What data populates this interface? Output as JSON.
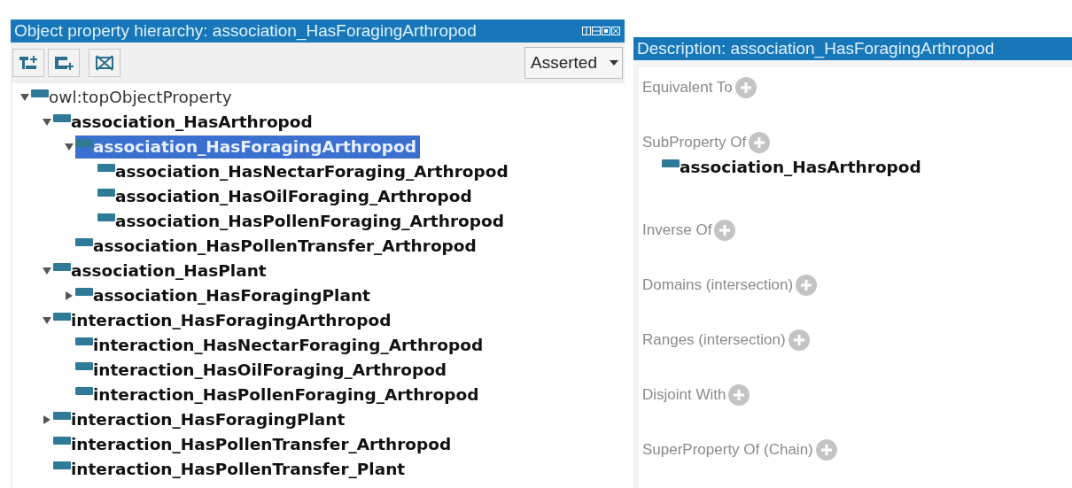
{
  "hierarchy_panel": {
    "title": "Object property hierarchy: association_HasForagingArthropod",
    "view_dropdown": "Asserted",
    "tree": [
      {
        "label": "owl:topObjectProperty",
        "kind": "root",
        "expanded": true,
        "selected": false,
        "children": [
          {
            "label": "association_HasArthropod",
            "kind": "property",
            "expanded": true,
            "selected": false,
            "children": [
              {
                "label": "association_HasForagingArthropod",
                "kind": "property",
                "expanded": true,
                "selected": true,
                "children": [
                  {
                    "label": "association_HasNectarForaging_Arthropod",
                    "kind": "property",
                    "selected": false
                  },
                  {
                    "label": "association_HasOilForaging_Arthropod",
                    "kind": "property",
                    "selected": false
                  },
                  {
                    "label": "association_HasPollenForaging_Arthropod",
                    "kind": "property",
                    "selected": false
                  }
                ]
              },
              {
                "label": "association_HasPollenTransfer_Arthropod",
                "kind": "property",
                "selected": false
              }
            ]
          },
          {
            "label": "association_HasPlant",
            "kind": "property",
            "expanded": true,
            "selected": false,
            "children": [
              {
                "label": "association_HasForagingPlant",
                "kind": "property",
                "expanded": false,
                "selected": false
              }
            ]
          },
          {
            "label": "interaction_HasForagingArthropod",
            "kind": "property",
            "expanded": true,
            "selected": false,
            "children": [
              {
                "label": "interaction_HasNectarForaging_Arthropod",
                "kind": "property",
                "selected": false
              },
              {
                "label": "interaction_HasOilForaging_Arthropod",
                "kind": "property",
                "selected": false
              },
              {
                "label": "interaction_HasPollenForaging_Arthropod",
                "kind": "property",
                "selected": false
              }
            ]
          },
          {
            "label": "interaction_HasForagingPlant",
            "kind": "property",
            "expanded": false,
            "selected": false
          },
          {
            "label": "interaction_HasPollenTransfer_Arthropod",
            "kind": "property",
            "selected": false
          },
          {
            "label": "interaction_HasPollenTransfer_Plant",
            "kind": "property",
            "selected": false
          }
        ]
      }
    ]
  },
  "description_panel": {
    "title": "Description: association_HasForagingArthropod",
    "sections": [
      {
        "label": "Equivalent To"
      },
      {
        "label": "SubProperty Of",
        "items": [
          "association_HasArthropod"
        ]
      },
      {
        "label": "Inverse Of"
      },
      {
        "label": "Domains (intersection)"
      },
      {
        "label": "Ranges (intersection)"
      },
      {
        "label": "Disjoint With"
      },
      {
        "label": "SuperProperty Of (Chain)"
      }
    ]
  }
}
